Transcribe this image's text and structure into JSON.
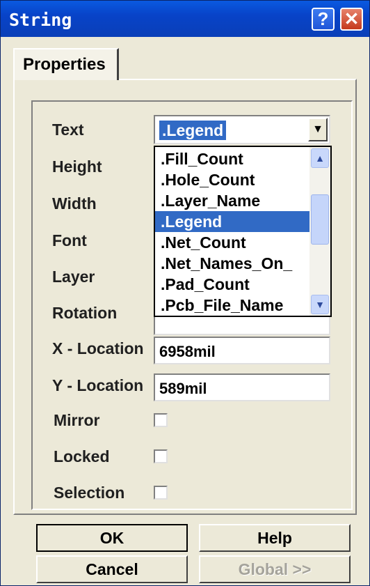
{
  "window": {
    "title": "String",
    "help_glyph": "?",
    "close_glyph": "✕",
    "title_color": "#0a4ad0"
  },
  "tabs": [
    {
      "label": "Properties",
      "selected": true
    }
  ],
  "fields": {
    "text": {
      "label": "Text",
      "value": ".Legend"
    },
    "height": {
      "label": "Height"
    },
    "width": {
      "label": "Width"
    },
    "font": {
      "label": "Font"
    },
    "layer": {
      "label": "Layer"
    },
    "rotation": {
      "label": "Rotation"
    },
    "x_location": {
      "label": "X - Location",
      "value": "6958mil"
    },
    "y_location": {
      "label": "Y - Location",
      "value": "589mil"
    },
    "mirror": {
      "label": "Mirror",
      "checked": false
    },
    "locked": {
      "label": "Locked",
      "checked": false
    },
    "selection": {
      "label": "Selection",
      "checked": false
    }
  },
  "dropdown": {
    "options": [
      ".Fill_Count",
      ".Hole_Count",
      ".Layer_Name",
      ".Legend",
      ".Net_Count",
      ".Net_Names_On_",
      ".Pad_Count",
      ".Pcb_File_Name"
    ],
    "selected_index": 3,
    "arrow_glyph": "▼",
    "scroll_up_icon": "chevron-up-icon",
    "scroll_down_icon": "chevron-down-icon",
    "highlight_color": "#316ac5"
  },
  "buttons": {
    "ok": "OK",
    "help": "Help",
    "cancel": "Cancel",
    "global": "Global >>"
  }
}
